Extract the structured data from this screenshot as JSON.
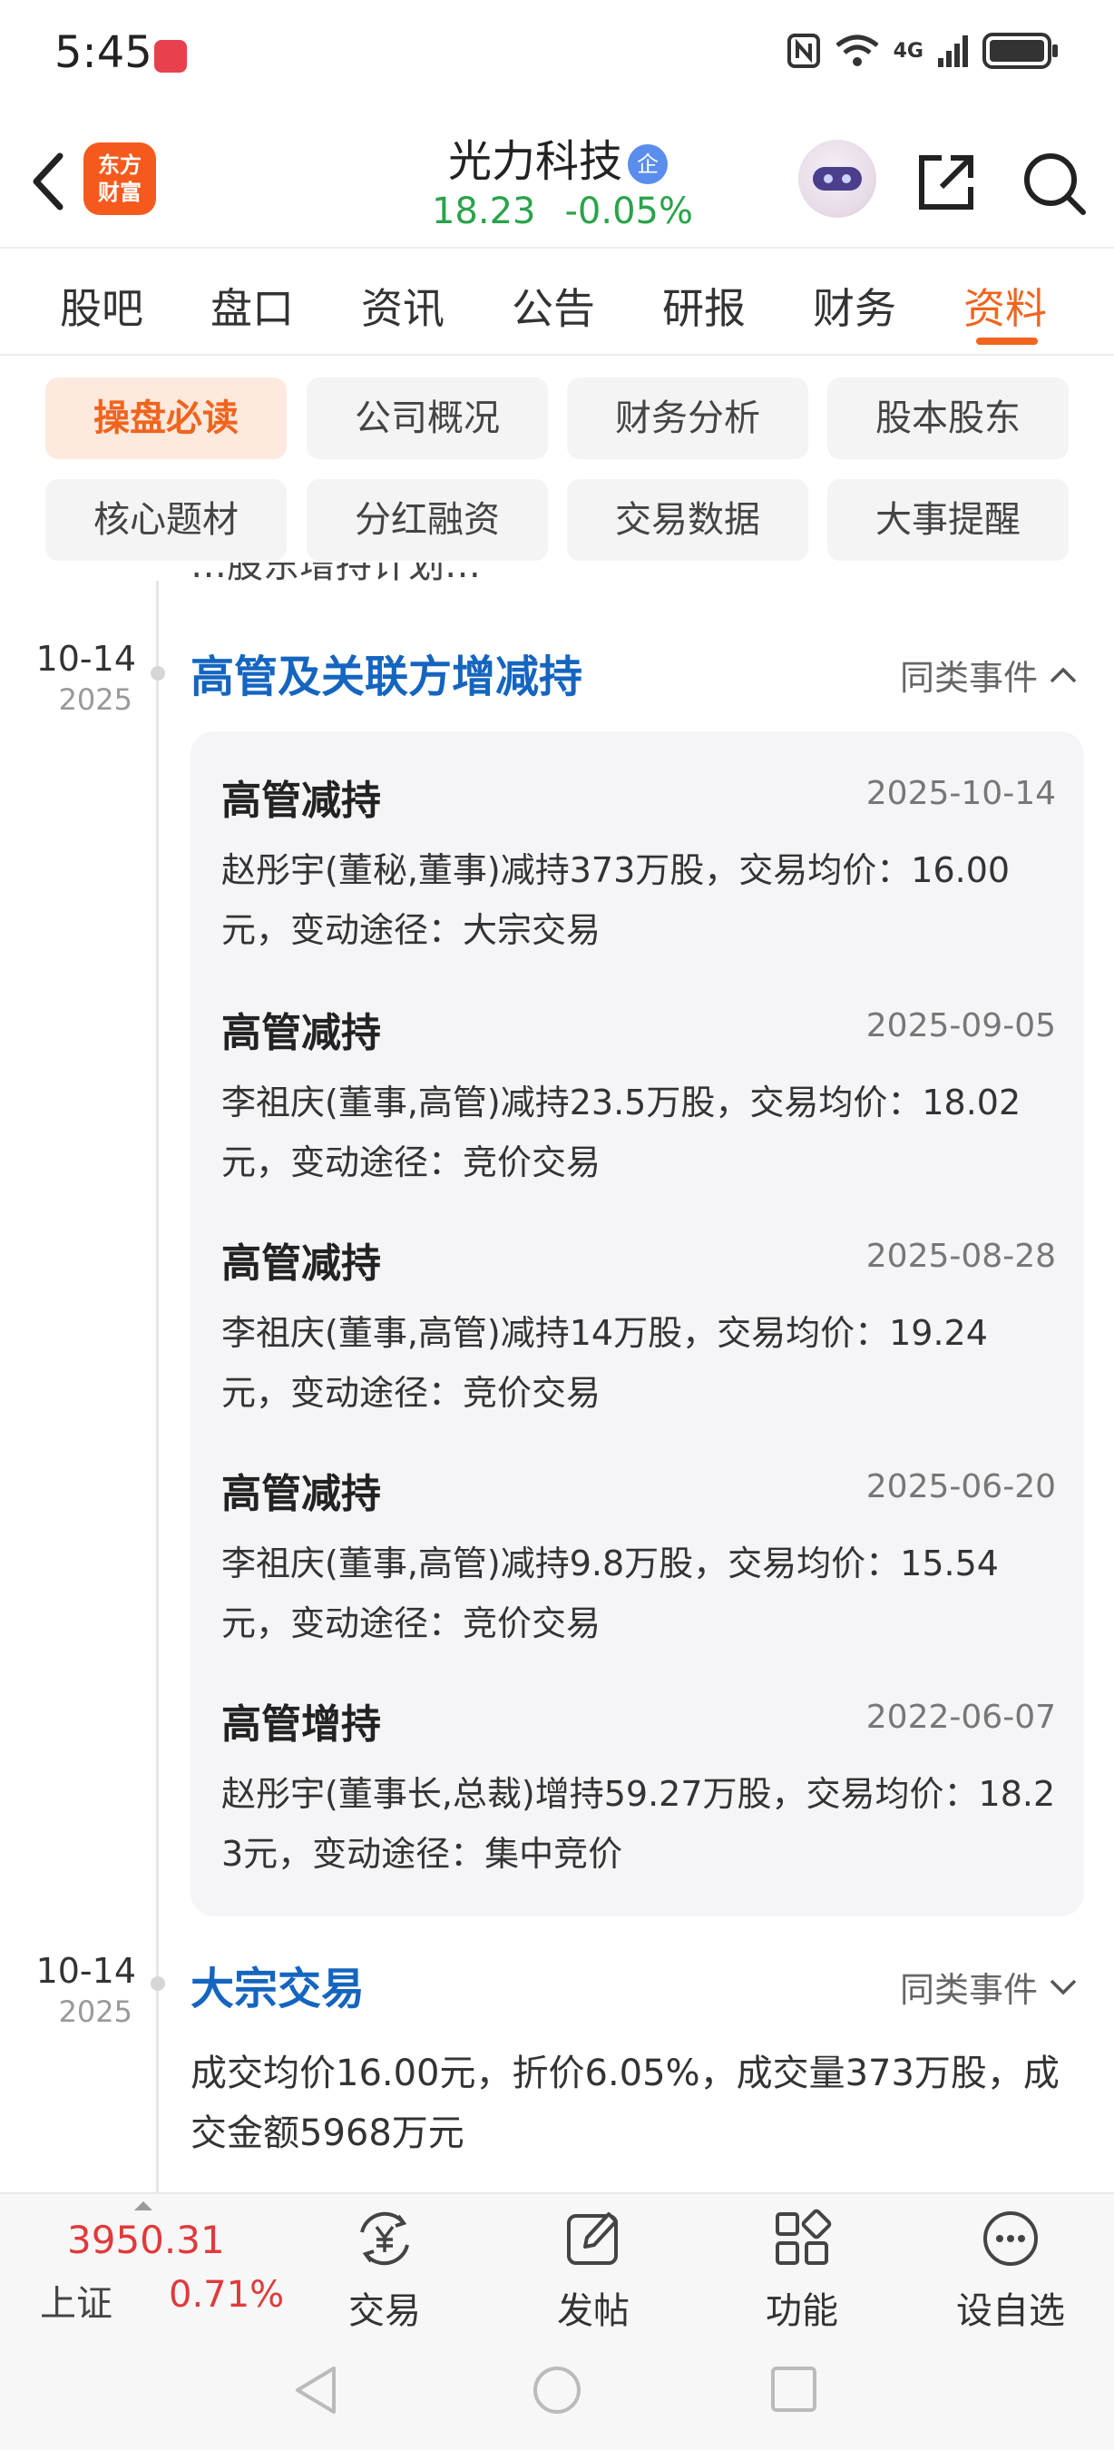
{
  "status_bar": {
    "time": "5:45",
    "network": "4G"
  },
  "header": {
    "back_icon": "back-arrow-icon",
    "app_logo_text": "东方财富",
    "stock_name": "光力科技",
    "badge": "企",
    "price": "18.23",
    "change": "-0.05%",
    "colors": {
      "price": "#2aa34a",
      "accent": "#f0641e",
      "link": "#1565c0",
      "rise": "#e03a3a"
    }
  },
  "tabs": [
    "股吧",
    "盘口",
    "资讯",
    "公告",
    "研报",
    "财务",
    "资料"
  ],
  "active_tab": "资料",
  "subtabs": [
    "操盘必读",
    "公司概况",
    "财务分析",
    "股本股东",
    "核心题材",
    "分红融资",
    "交易数据",
    "大事提醒"
  ],
  "active_subtab": "操盘必读",
  "partial_text": "…股东增持计划…",
  "events": [
    {
      "date": "10-14",
      "year": "2025",
      "title": "高管及关联方增减持",
      "similar": "同类事件",
      "expanded": true,
      "items": [
        {
          "title": "高管减持",
          "date": "2025-10-14",
          "text": "赵彤宇(董秘,董事)减持373万股，交易均价：16.00元，变动途径：大宗交易"
        },
        {
          "title": "高管减持",
          "date": "2025-09-05",
          "text": "李祖庆(董事,高管)减持23.5万股，交易均价：18.02元，变动途径：竞价交易"
        },
        {
          "title": "高管减持",
          "date": "2025-08-28",
          "text": "李祖庆(董事,高管)减持14万股，交易均价：19.24元，变动途径：竞价交易"
        },
        {
          "title": "高管减持",
          "date": "2025-06-20",
          "text": "李祖庆(董事,高管)减持9.8万股，交易均价：15.54元，变动途径：竞价交易"
        },
        {
          "title": "高管增持",
          "date": "2022-06-07",
          "text": "赵彤宇(董事长,总裁)增持59.27万股，交易均价：18.23元，变动途径：集中竞价"
        }
      ]
    },
    {
      "date": "10-14",
      "year": "2025",
      "title": "大宗交易",
      "similar": "同类事件",
      "expanded": false,
      "description": "成交均价16.00元，折价6.05%，成交量373万股，成交金额5968万元"
    }
  ],
  "bottom_bar": {
    "index_value": "3950.31",
    "index_name": "上证",
    "index_change": "0.71%",
    "items": [
      {
        "label": "交易",
        "icon": "trade-yen-icon"
      },
      {
        "label": "发帖",
        "icon": "edit-post-icon"
      },
      {
        "label": "功能",
        "icon": "grid-apps-icon"
      },
      {
        "label": "设自选",
        "icon": "more-circle-icon"
      }
    ]
  }
}
